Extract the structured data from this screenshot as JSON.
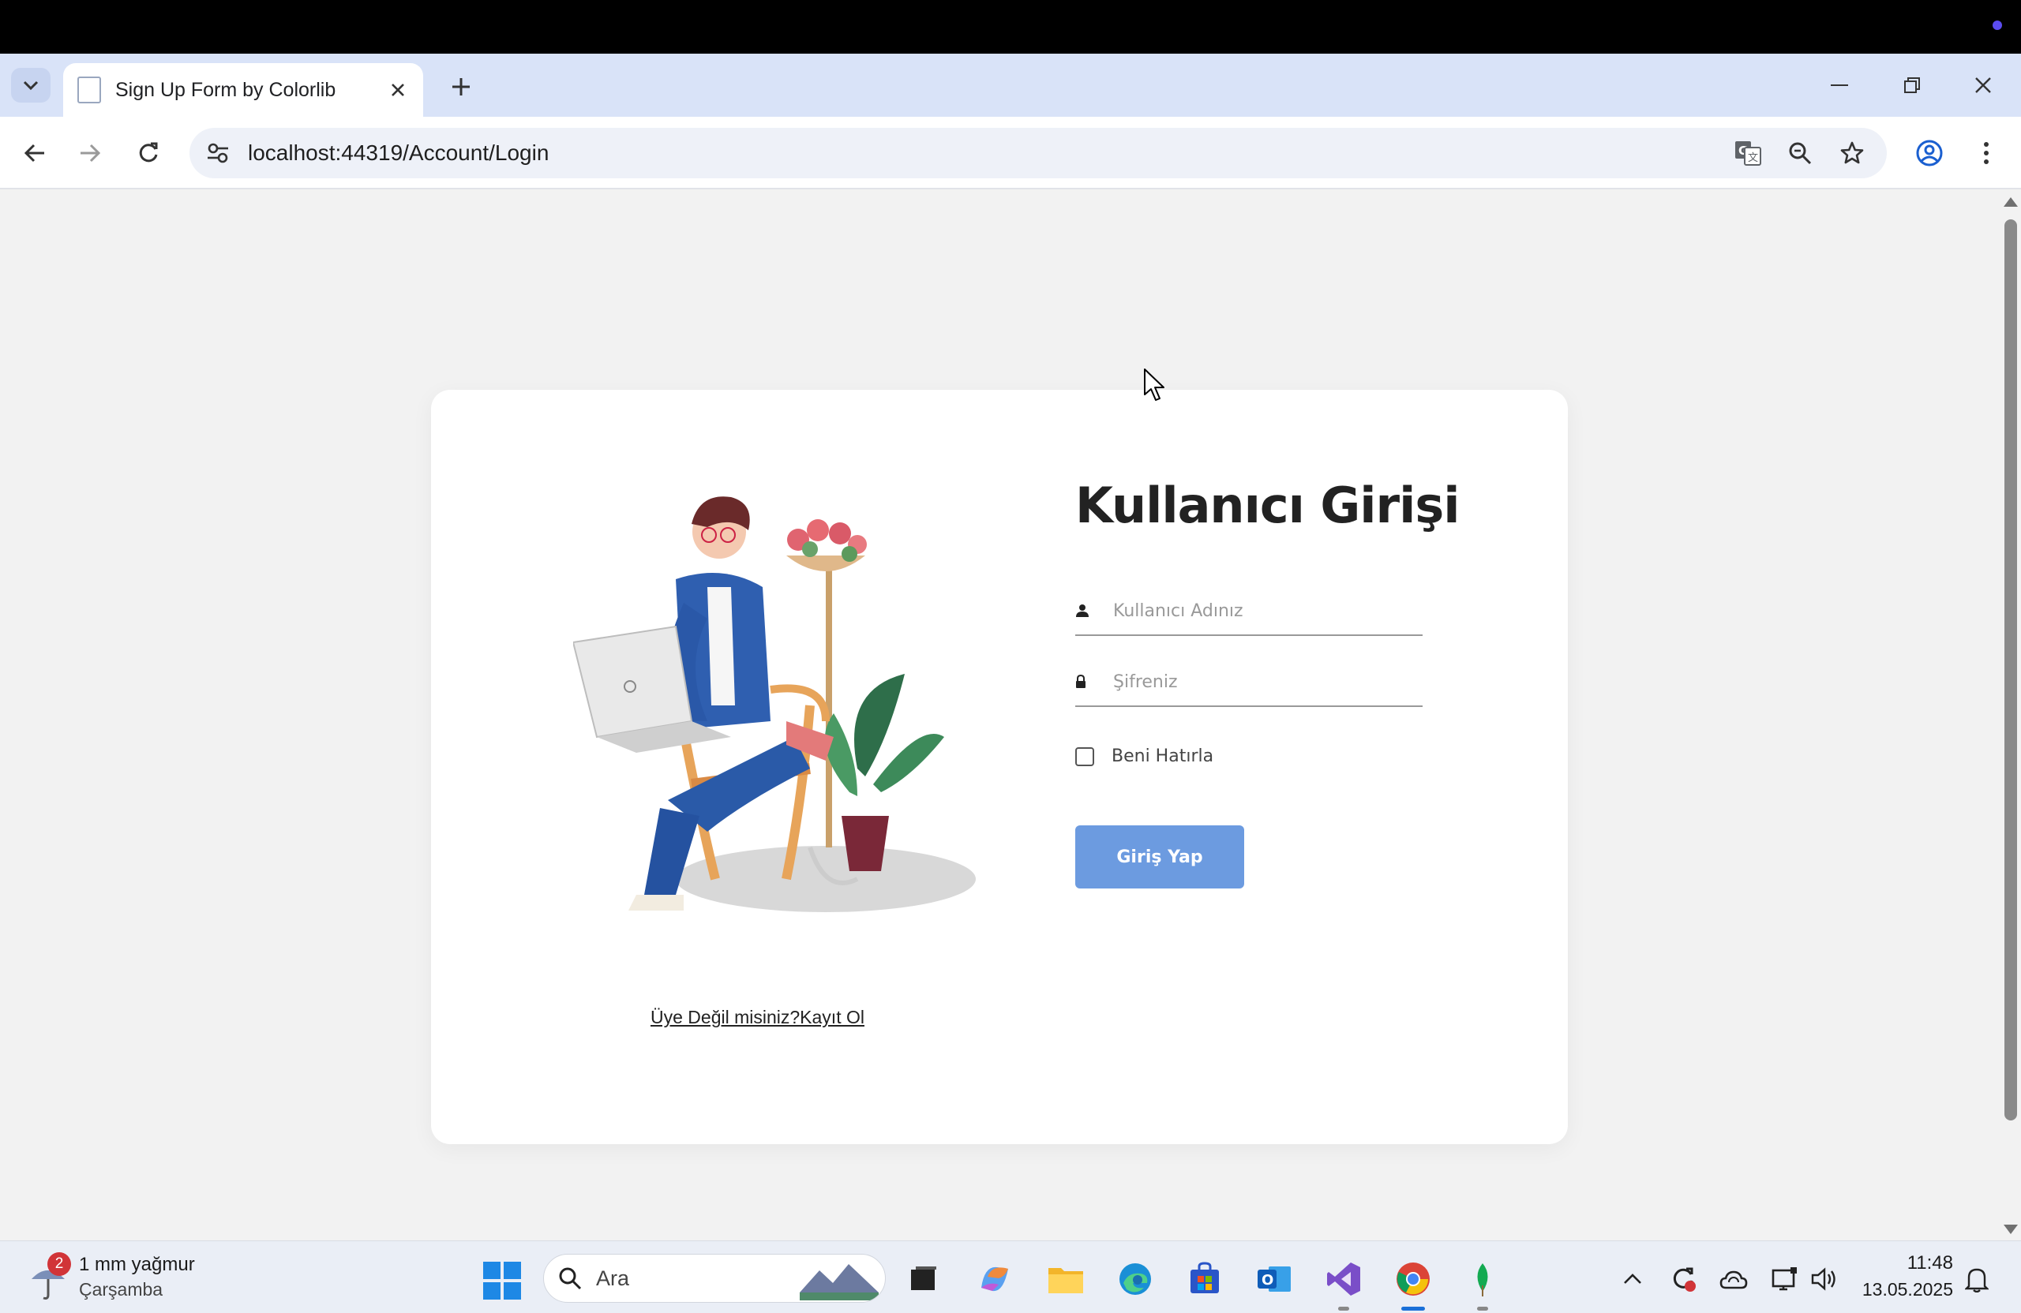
{
  "browser": {
    "tab_title": "Sign Up Form by Colorlib",
    "url": "localhost:44319/Account/Login"
  },
  "login": {
    "title": "Kullanıcı Girişi",
    "username_placeholder": "Kullanıcı Adınız",
    "password_placeholder": "Şifreniz",
    "remember_label": "Beni Hatırla",
    "submit_label": "Giriş Yap",
    "signup_link": "Üye Değil misiniz?Kayıt Ol"
  },
  "taskbar": {
    "weather_temp": "1 mm yağmur",
    "weather_day": "Çarşamba",
    "weather_badge": "2",
    "search_placeholder": "Ara",
    "time": "11:48",
    "date": "13.05.2025"
  },
  "colors": {
    "button": "#6c9be0",
    "tabstrip": "#d9e3f8",
    "page_bg": "#f2f2f2"
  }
}
